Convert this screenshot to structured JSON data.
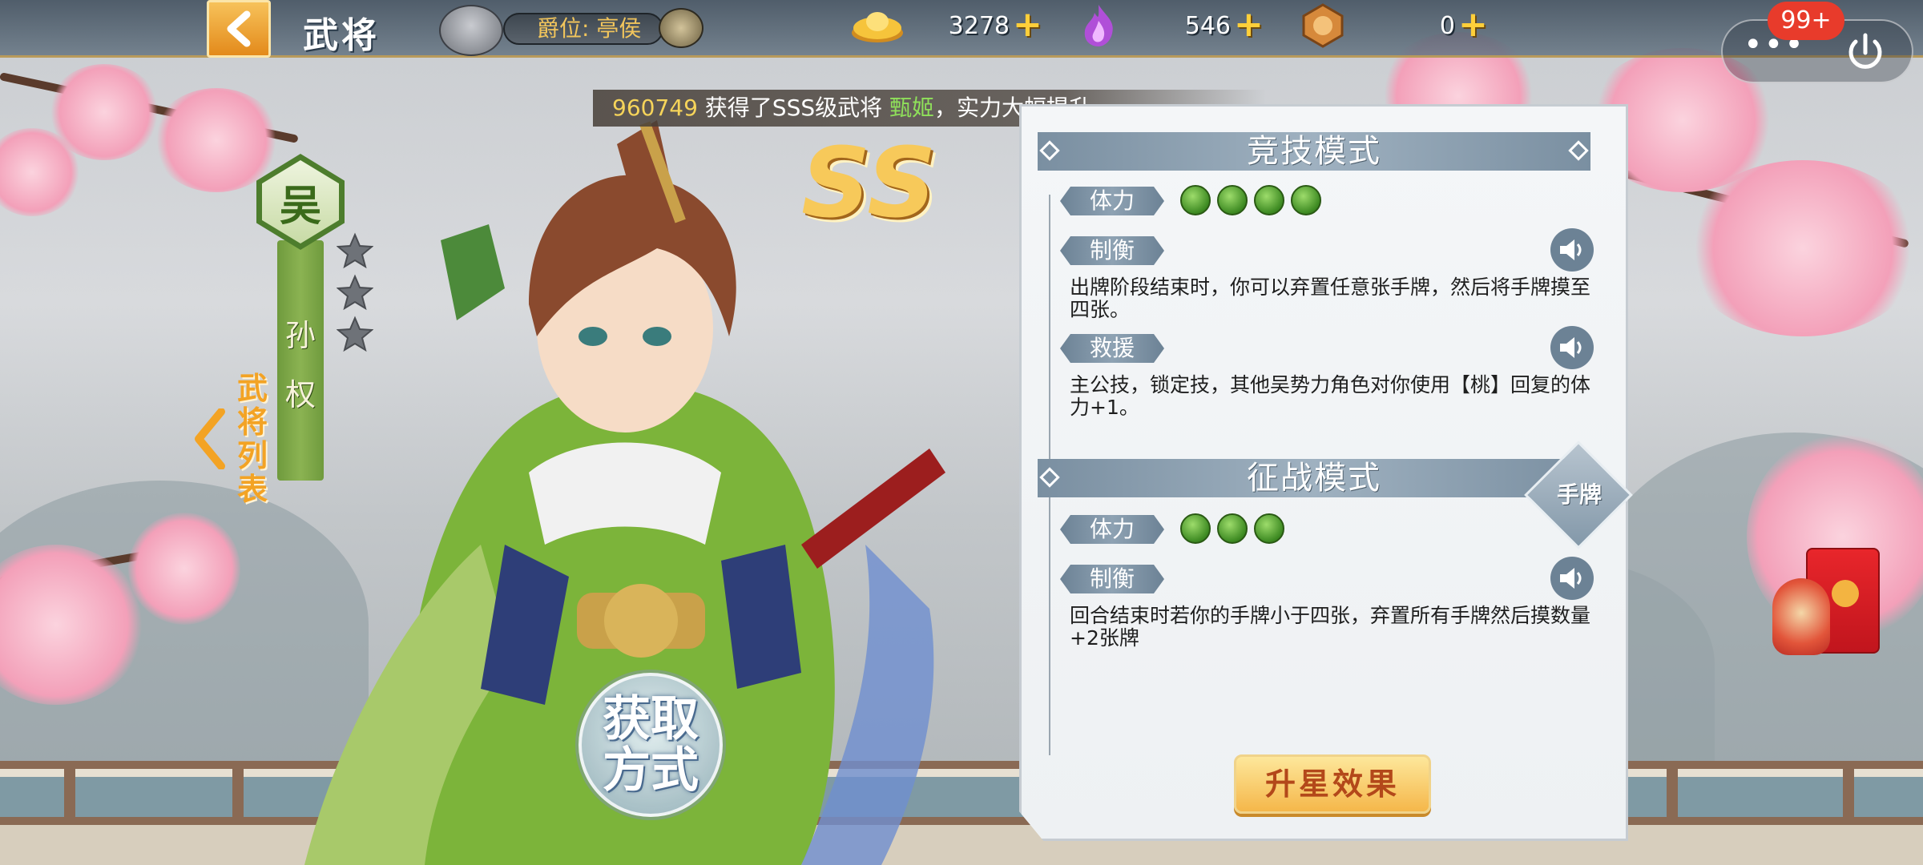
{
  "header": {
    "title": "武将",
    "rank_label": "爵位: 亭侯",
    "currencies": [
      {
        "name": "gold-ingot",
        "value": "3278",
        "color": "#f6c43b"
      },
      {
        "name": "purple-flame",
        "value": "546",
        "color": "#b04fd8"
      },
      {
        "name": "token-coin",
        "value": "0",
        "color": "#d6893b"
      }
    ],
    "plus_glyph": "+",
    "more_glyph": "•••",
    "notification_badge": "99+"
  },
  "broadcast": {
    "uid": "960749",
    "text_before": " 获得了SSS级武将 ",
    "hero_name": "甄姬",
    "text_after": "，实力大幅提升"
  },
  "hero": {
    "faction": "吴",
    "name_chars": [
      "孙",
      "权"
    ],
    "stars": 3,
    "rarity": "SS",
    "list_tab_chars": [
      "武",
      "将",
      "列",
      "表"
    ],
    "get_way_lines": [
      "获取",
      "方式"
    ]
  },
  "arena_mode": {
    "title": "竞技模式",
    "hp_label": "体力",
    "hp_count": 4,
    "skills": [
      {
        "name": "制衡",
        "desc": "出牌阶段结束时，你可以弃置任意张手牌，然后将手牌摸至四张。"
      },
      {
        "name": "救援",
        "desc": "主公技，锁定技，其他吴势力角色对你使用【桃】回复的体力+1。"
      }
    ]
  },
  "campaign_mode": {
    "title": "征战模式",
    "hp_label": "体力",
    "hp_count": 3,
    "hand_badge": "手牌",
    "skills": [
      {
        "name": "制衡",
        "desc": "回合结束时若你的手牌小于四张，弃置所有手牌然后摸数量+2张牌"
      }
    ]
  },
  "upgrade_button": "升星效果",
  "colors": {
    "accent_gold": "#f5b74a",
    "faction_green": "#4d7d2d",
    "panel_header": "#7a8fa1",
    "badge_red": "#e83b2b"
  }
}
